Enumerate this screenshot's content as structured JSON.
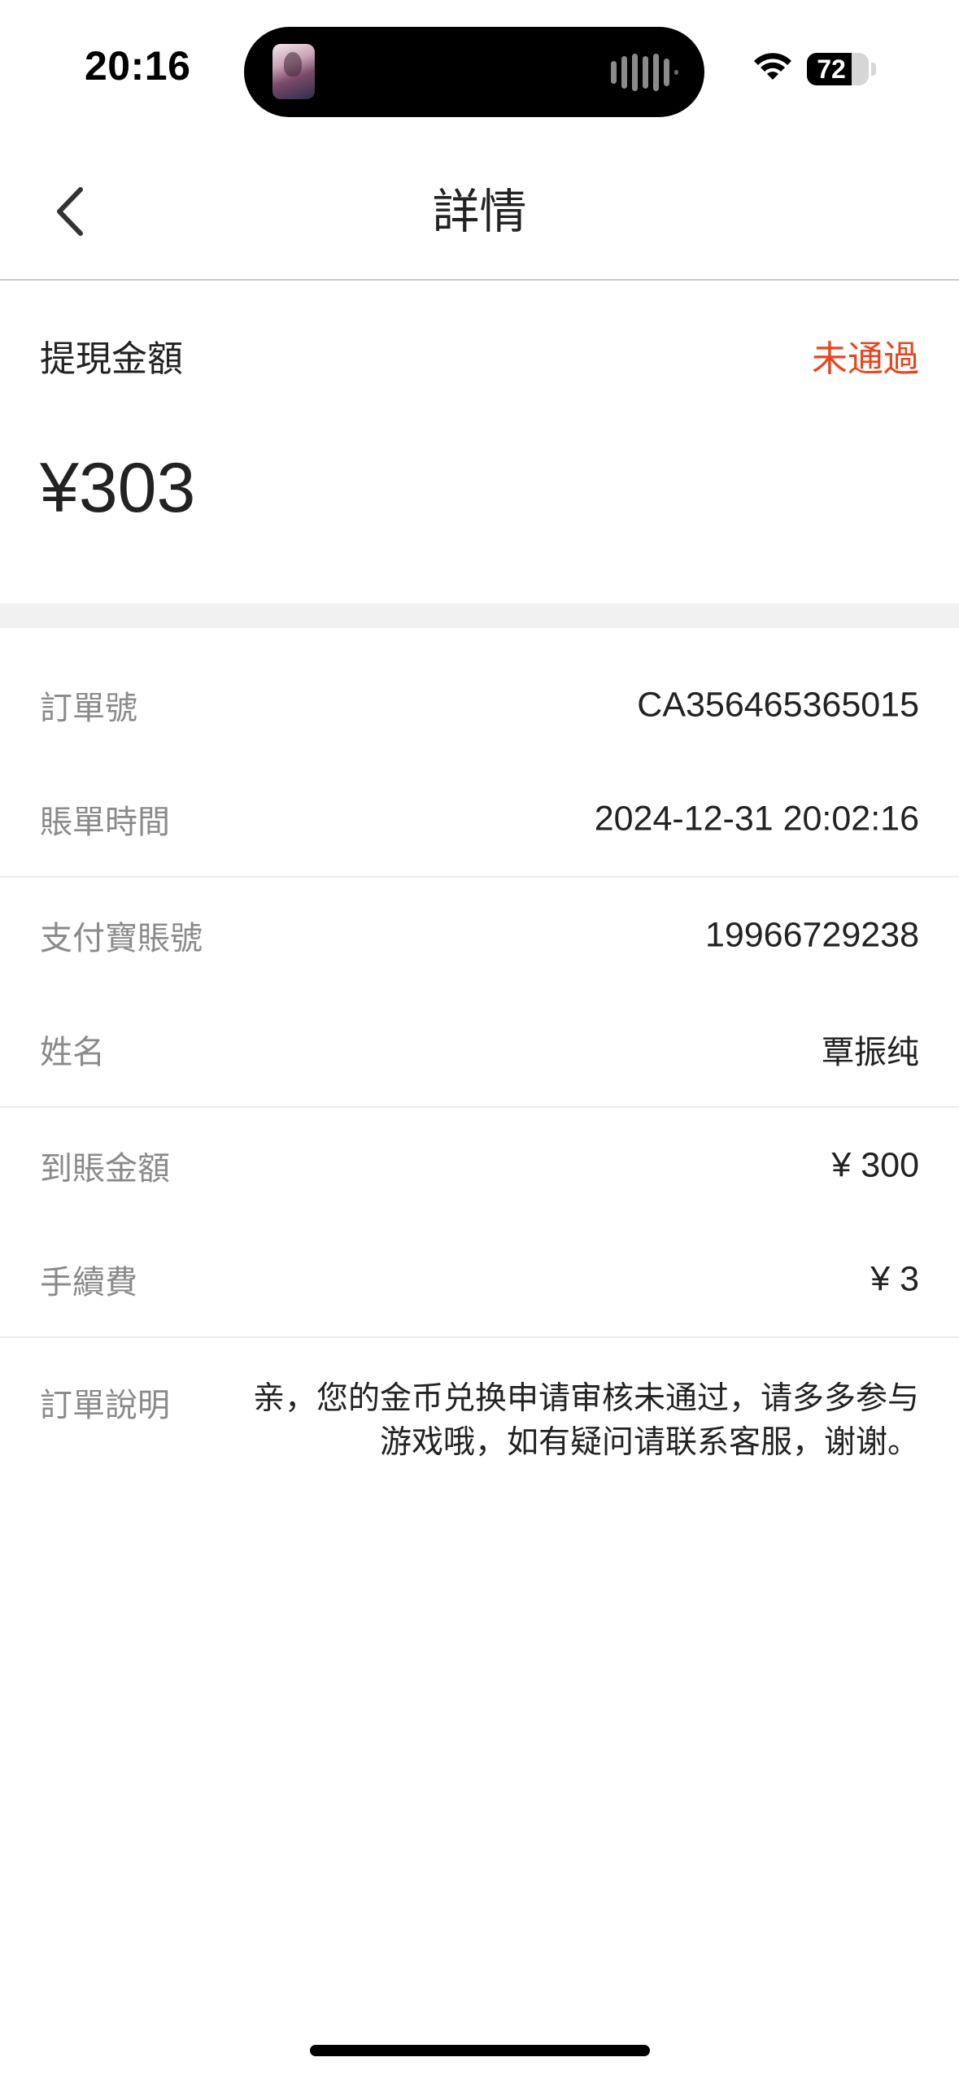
{
  "status_bar": {
    "time": "20:16",
    "battery_level": "72",
    "battery_fraction": 0.72,
    "icons": [
      "app-thumbnail-icon",
      "audio-waveform-icon",
      "wifi-icon",
      "battery-icon"
    ]
  },
  "nav": {
    "title": "詳情",
    "back_icon": "chevron-left-icon"
  },
  "summary": {
    "label": "提現金額",
    "status": "未通過",
    "status_color": "#e8461e",
    "amount": "¥303"
  },
  "details": [
    {
      "label": "訂單號",
      "value": "CA356465365015"
    },
    {
      "label": "賬單時間",
      "value": "2024-12-31 20:02:16"
    },
    {
      "label": "支付寶賬號",
      "value": "19966729238"
    },
    {
      "label": "姓名",
      "value": "覃振纯"
    },
    {
      "label": "到賬金額",
      "value": "¥ 300"
    },
    {
      "label": "手續費",
      "value": "¥ 3"
    }
  ],
  "note": {
    "label": "訂單說明",
    "text": "亲，您的金币兑换申请审核未通过，请多多参与游戏哦，如有疑问请联系客服，谢谢。"
  }
}
